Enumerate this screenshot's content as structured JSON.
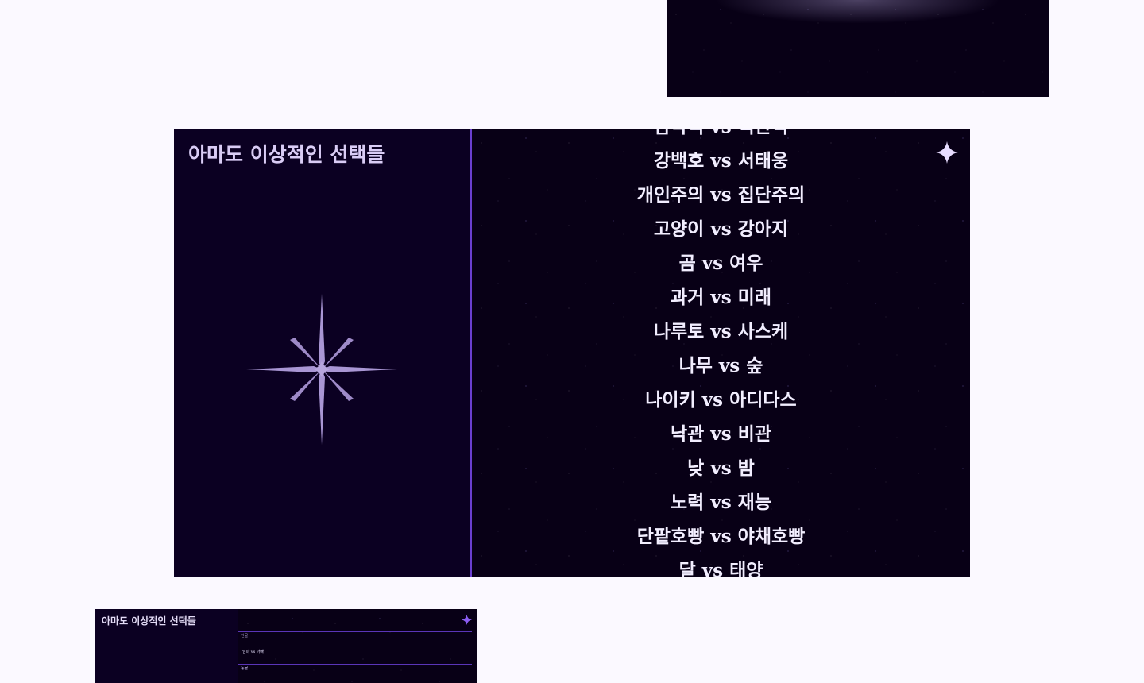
{
  "title": "아마도 이상적인 선택들",
  "choices": [
    "감각적 vs 직관적",
    "강백호 vs 서태웅",
    "개인주의 vs 집단주의",
    "고양이 vs 강아지",
    "곰 vs 여우",
    "과거 vs 미래",
    "나루토 vs 사스케",
    "나무 vs 숲",
    "나이키 vs 아디다스",
    "낙관 vs 비관",
    "낮 vs 밤",
    "노력 vs 재능",
    "단팥호빵 vs 야채호빵",
    "달 vs 태양"
  ],
  "thumbnail": {
    "title": "아마도 이상적인 선택들",
    "category_1": "인물",
    "pair_1": "엄마 vs 아빠",
    "category_2": "동물"
  },
  "colors": {
    "background": "#fbf9ff",
    "panel": "#0b0022",
    "divider": "#6a3fcf",
    "title": "#d9ccf5",
    "star": "#a692d0",
    "sparkle": "#e7dcff"
  },
  "icons": {
    "center": "compass-star-icon",
    "corner": "sparkle-icon"
  }
}
